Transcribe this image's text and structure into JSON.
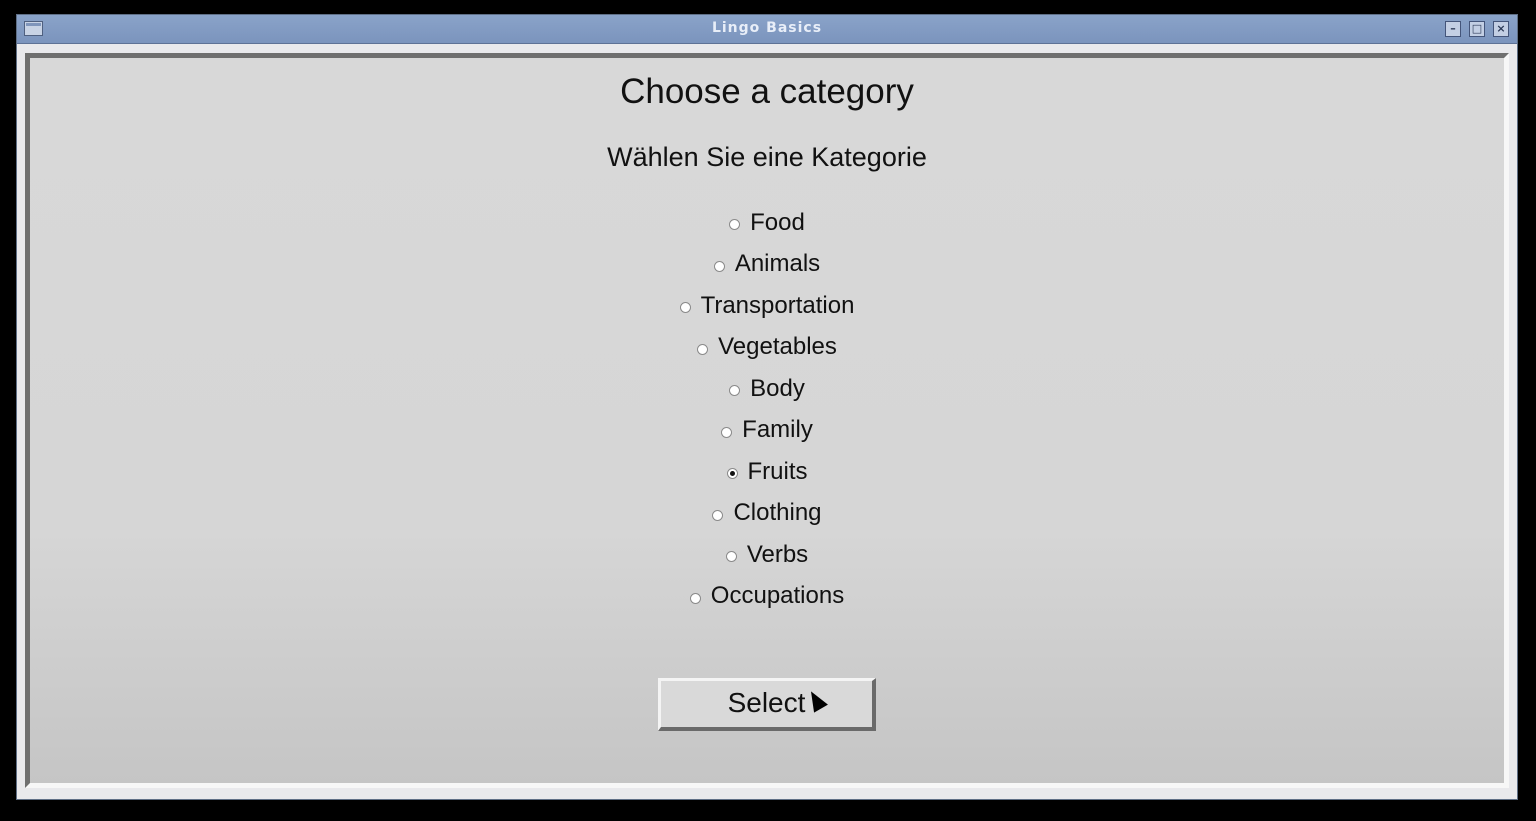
{
  "window": {
    "title": "Lingo Basics"
  },
  "main": {
    "heading": "Choose a category",
    "subheading": "Wählen Sie eine Kategorie",
    "categories": [
      {
        "label": "Food",
        "selected": false
      },
      {
        "label": "Animals",
        "selected": false
      },
      {
        "label": "Transportation",
        "selected": false
      },
      {
        "label": "Vegetables",
        "selected": false
      },
      {
        "label": "Body",
        "selected": false
      },
      {
        "label": "Family",
        "selected": false
      },
      {
        "label": "Fruits",
        "selected": true
      },
      {
        "label": "Clothing",
        "selected": false
      },
      {
        "label": "Verbs",
        "selected": false
      },
      {
        "label": "Occupations",
        "selected": false
      }
    ],
    "select_label": "Select"
  },
  "icons": {
    "window_menu": "window-menu-icon",
    "minimize": "minimize-icon",
    "maximize": "maximize-icon",
    "close": "close-icon"
  }
}
